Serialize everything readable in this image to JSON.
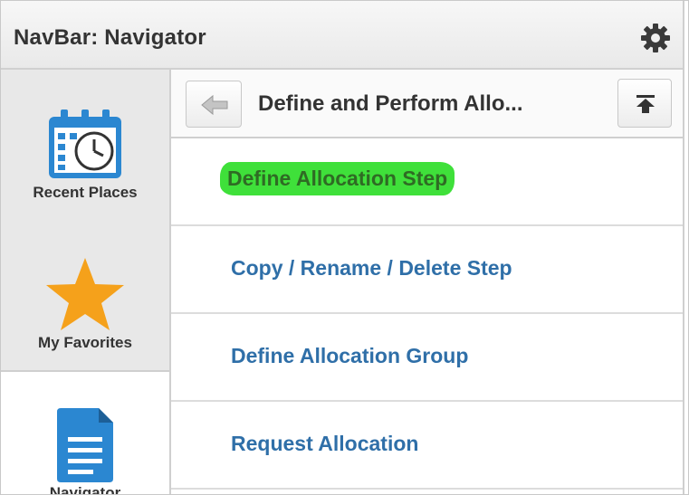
{
  "navbar": {
    "title": "NavBar: Navigator",
    "settings_icon": "gear-icon"
  },
  "sidebar": {
    "items": [
      {
        "label": "Recent Places",
        "icon": "calendar-clock-icon"
      },
      {
        "label": "My Favorites",
        "icon": "star-icon"
      },
      {
        "label": "Navigator",
        "icon": "document-icon",
        "selected": true
      }
    ]
  },
  "main": {
    "title": "Define and Perform Allo...",
    "back_icon": "arrow-left-icon",
    "top_icon": "arrow-to-top-icon",
    "items": [
      {
        "label": "Define Allocation Step",
        "highlighted": true
      },
      {
        "label": "Copy / Rename / Delete Step"
      },
      {
        "label": "Define Allocation Group"
      },
      {
        "label": "Request Allocation"
      }
    ]
  },
  "colors": {
    "link": "#2f6fa8",
    "highlight": "#3fe03a",
    "calendar_blue": "#2b87d1",
    "star_orange": "#f5a11b",
    "doc_blue": "#2b87d1"
  }
}
